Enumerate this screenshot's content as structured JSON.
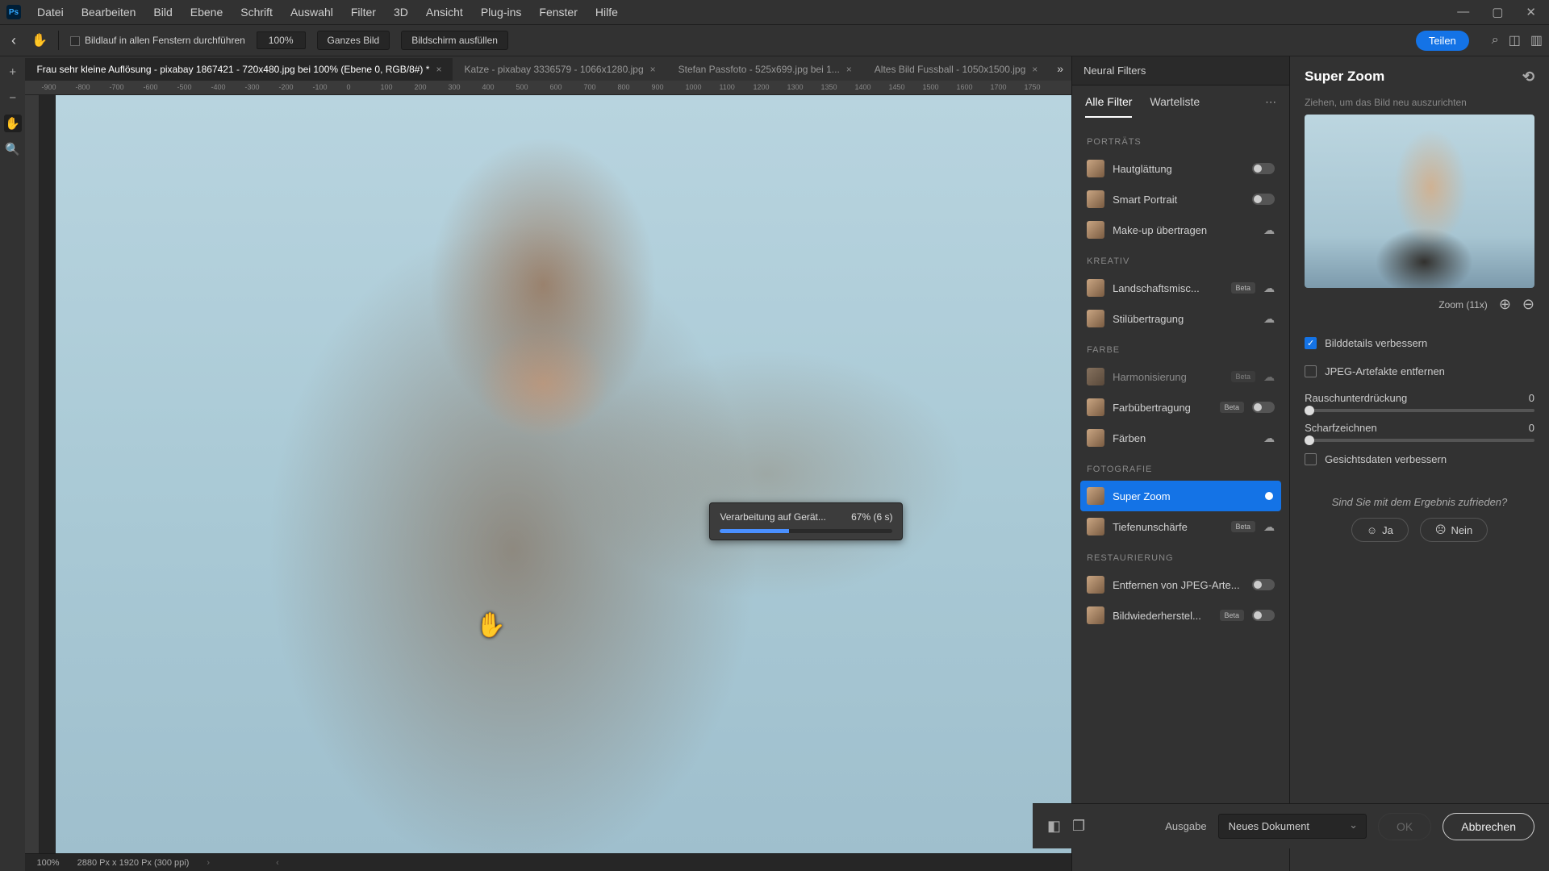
{
  "menu": {
    "items": [
      "Datei",
      "Bearbeiten",
      "Bild",
      "Ebene",
      "Schrift",
      "Auswahl",
      "Filter",
      "3D",
      "Ansicht",
      "Plug-ins",
      "Fenster",
      "Hilfe"
    ]
  },
  "optbar": {
    "scroll_all": "Bildlauf in allen Fenstern durchführen",
    "zoom": "100%",
    "fit": "Ganzes Bild",
    "fill": "Bildschirm ausfüllen",
    "share": "Teilen"
  },
  "tabs": [
    {
      "label": "Frau sehr kleine Auflösung - pixabay 1867421 - 720x480.jpg bei 100% (Ebene 0, RGB/8#) *",
      "active": true
    },
    {
      "label": "Katze - pixabay 3336579 - 1066x1280.jpg",
      "active": false
    },
    {
      "label": "Stefan Passfoto - 525x699.jpg bei 1...",
      "active": false
    },
    {
      "label": "Altes Bild Fussball - 1050x1500.jpg",
      "active": false
    }
  ],
  "ruler_h": [
    "-900",
    "-800",
    "-700",
    "-600",
    "-500",
    "-400",
    "-300",
    "-200",
    "-100",
    "0",
    "100",
    "200",
    "300",
    "400",
    "500",
    "600",
    "700",
    "800",
    "900",
    "1000",
    "1100",
    "1200",
    "1300",
    "1350",
    "1400",
    "1450",
    "1500",
    "1600",
    "1700",
    "1750"
  ],
  "progress": {
    "label": "Verarbeitung auf Gerät...",
    "pct": "67% (6 s)",
    "fill": 40
  },
  "status": {
    "zoom": "100%",
    "dims": "2880 Px x 1920 Px (300 ppi)"
  },
  "nf": {
    "panel_title": "Neural Filters",
    "subtabs": {
      "all": "Alle Filter",
      "wait": "Warteliste"
    },
    "groups": [
      {
        "head": "PORTRÄTS",
        "items": [
          {
            "label": "Hautglättung",
            "ctrl": "toggle"
          },
          {
            "label": "Smart Portrait",
            "ctrl": "toggle"
          },
          {
            "label": "Make-up übertragen",
            "ctrl": "cloud"
          }
        ]
      },
      {
        "head": "KREATIV",
        "items": [
          {
            "label": "Landschaftsmisc...",
            "beta": true,
            "ctrl": "cloud"
          },
          {
            "label": "Stilübertragung",
            "ctrl": "cloud"
          }
        ]
      },
      {
        "head": "FARBE",
        "items": [
          {
            "label": "Harmonisierung",
            "beta": true,
            "ctrl": "cloud",
            "dim": true
          },
          {
            "label": "Farbübertragung",
            "beta": true,
            "ctrl": "toggle"
          },
          {
            "label": "Färben",
            "ctrl": "cloud"
          }
        ]
      },
      {
        "head": "FOTOGRAFIE",
        "items": [
          {
            "label": "Super Zoom",
            "ctrl": "toggle",
            "on": true,
            "sel": true
          },
          {
            "label": "Tiefenunschärfe",
            "beta": true,
            "ctrl": "cloud"
          }
        ]
      },
      {
        "head": "RESTAURIERUNG",
        "items": [
          {
            "label": "Entfernen von JPEG-Arte...",
            "ctrl": "toggle"
          },
          {
            "label": "Bildwiederherstel...",
            "beta": true,
            "ctrl": "toggle"
          }
        ]
      }
    ]
  },
  "sz": {
    "title": "Super Zoom",
    "hint": "Ziehen, um das Bild neu auszurichten",
    "zoom_label": "Zoom (11x)",
    "checks": [
      {
        "label": "Bilddetails verbessern",
        "on": true
      },
      {
        "label": "JPEG-Artefakte entfernen",
        "on": false
      }
    ],
    "sliders": [
      {
        "label": "Rauschunterdrückung",
        "val": "0"
      },
      {
        "label": "Scharfzeichnen",
        "val": "0"
      }
    ],
    "check_face": {
      "label": "Gesichtsdaten verbessern",
      "on": false
    },
    "satisfied": "Sind Sie mit dem Ergebnis zufrieden?",
    "yes": "Ja",
    "no": "Nein"
  },
  "footer": {
    "out": "Ausgabe",
    "sel": "Neues Dokument",
    "ok": "OK",
    "cancel": "Abbrechen"
  }
}
